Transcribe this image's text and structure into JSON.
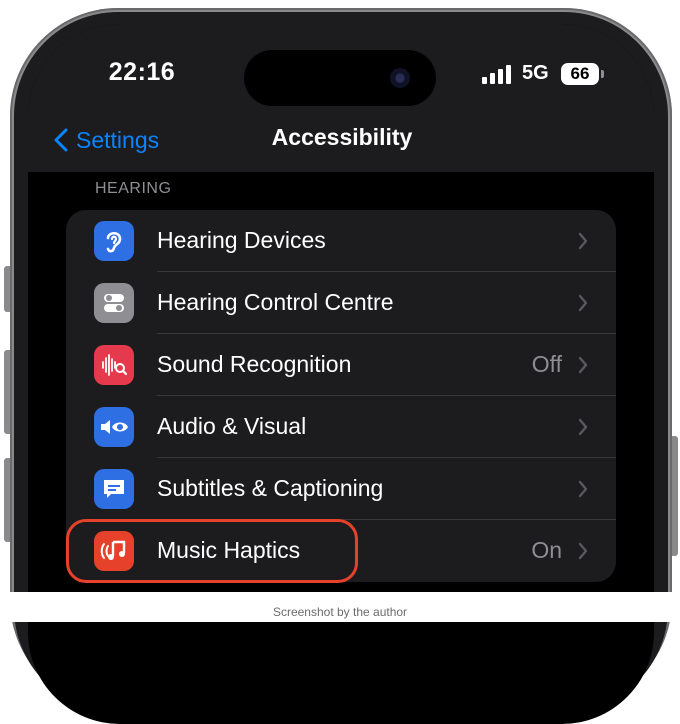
{
  "status_bar": {
    "time": "22:16",
    "network": "5G",
    "battery": "66",
    "icons": [
      "signal-bars-icon",
      "battery-icon"
    ]
  },
  "nav": {
    "back_label": "Settings",
    "title": "Accessibility",
    "back_icon": "chevron-left-icon"
  },
  "section": {
    "header": "HEARING"
  },
  "rows": [
    {
      "label": "Hearing Devices",
      "value": "",
      "icon": "ear-icon",
      "color": "#2f6fe4"
    },
    {
      "label": "Hearing Control Centre",
      "value": "",
      "icon": "toggle-switches-icon",
      "color": "#8e8e93"
    },
    {
      "label": "Sound Recognition",
      "value": "Off",
      "icon": "waveform-search-icon",
      "color": "#e5394e"
    },
    {
      "label": "Audio & Visual",
      "value": "",
      "icon": "speaker-eye-icon",
      "color": "#2f6fe4"
    },
    {
      "label": "Subtitles & Captioning",
      "value": "",
      "icon": "caption-bubble-icon",
      "color": "#2f6fe4"
    },
    {
      "label": "Music Haptics",
      "value": "On",
      "icon": "music-haptics-icon",
      "color": "#e5412b"
    }
  ],
  "highlight_color": "#e5412b",
  "caption": "Screenshot by the author"
}
